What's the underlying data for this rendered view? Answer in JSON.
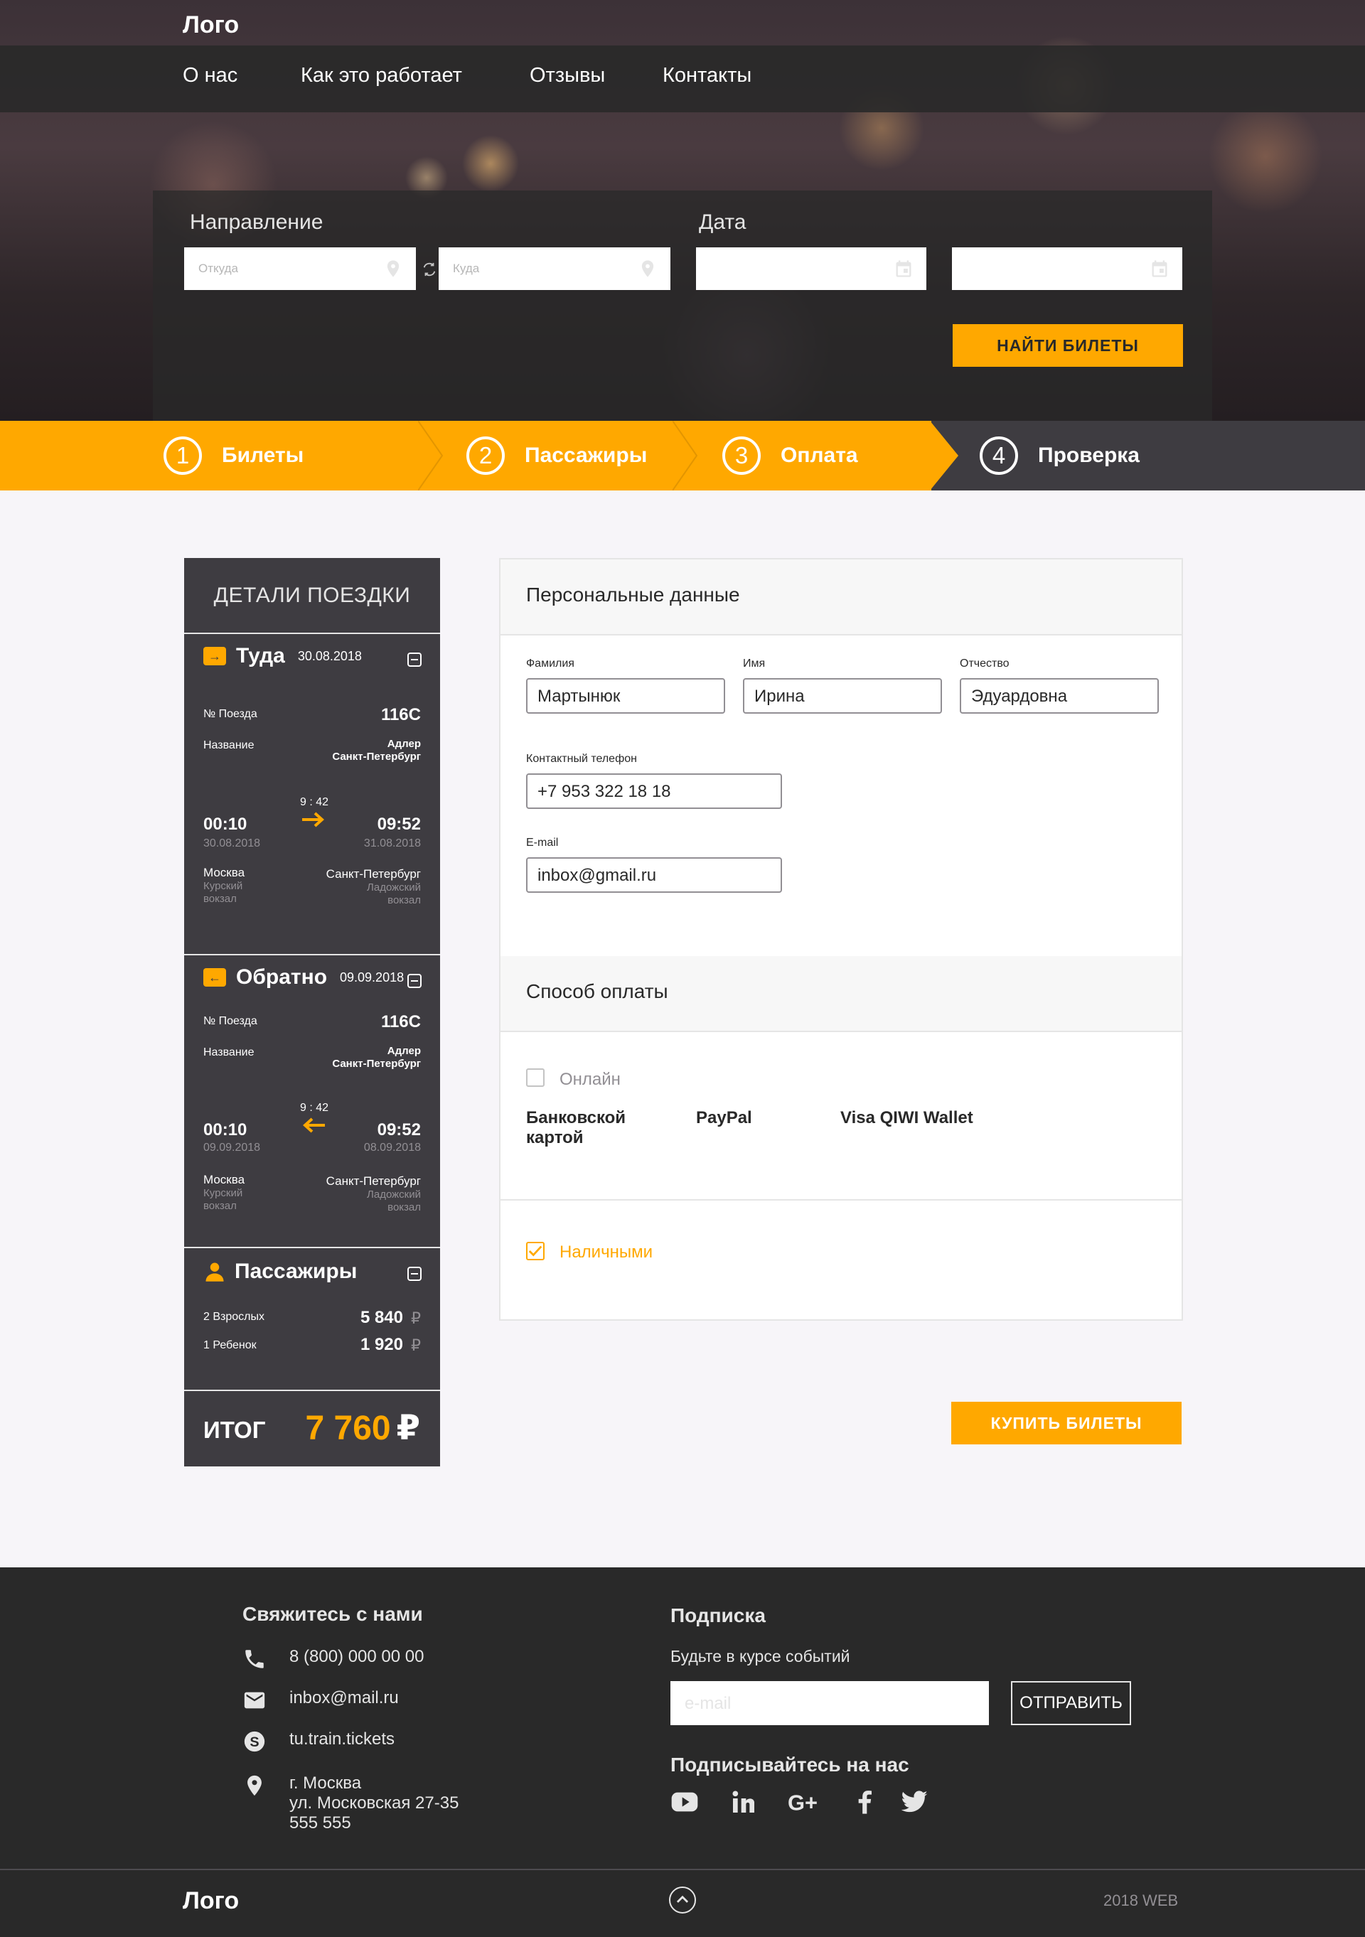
{
  "header": {
    "logo": "Лого",
    "nav": [
      "О нас",
      "Как это работает",
      "Отзывы",
      "Контакты"
    ]
  },
  "search": {
    "direction_label": "Направление",
    "date_label": "Дата",
    "from_placeholder": "Откуда",
    "to_placeholder": "Куда",
    "find_button": "НАЙТИ БИЛЕТЫ"
  },
  "steps": [
    {
      "num": "1",
      "label": "Билеты"
    },
    {
      "num": "2",
      "label": "Пассажиры"
    },
    {
      "num": "3",
      "label": "Оплата"
    },
    {
      "num": "4",
      "label": "Проверка"
    }
  ],
  "trip": {
    "title": "ДЕТАЛИ ПОЕЗДКИ",
    "there": {
      "title": "Туда",
      "date": "30.08.2018",
      "train_label": "№ Поезда",
      "train_no": "116С",
      "name_label": "Название",
      "name_line1": "Адлер",
      "name_line2": "Санкт-Петербург",
      "duration": "9 : 42",
      "dep_time": "00:10",
      "dep_date": "30.08.2018",
      "arr_time": "09:52",
      "arr_date": "31.08.2018",
      "dep_city": "Москва",
      "dep_station1": "Курский",
      "dep_station2": "вокзал",
      "arr_city": "Санкт-Петербург",
      "arr_station1": "Ладожский",
      "arr_station2": "вокзал"
    },
    "back": {
      "title": "Обратно",
      "date": "09.09.2018",
      "train_label": "№ Поезда",
      "train_no": "116С",
      "name_label": "Название",
      "name_line1": "Адлер",
      "name_line2": "Санкт-Петербург",
      "duration": "9 : 42",
      "dep_time": "00:10",
      "dep_date": "09.09.2018",
      "arr_time": "09:52",
      "arr_date": "08.09.2018",
      "dep_city": "Москва",
      "dep_station1": "Курский",
      "dep_station2": "вокзал",
      "arr_city": "Санкт-Петербург",
      "arr_station1": "Ладожский",
      "arr_station2": "вокзал"
    },
    "passengers": {
      "title": "Пассажиры",
      "adults_label": "2 Взрослых",
      "adults_price": "5 840",
      "child_label": "1 Ребенок",
      "child_price": "1 920",
      "currency": "₽"
    },
    "total_label": "ИТОГ",
    "total_value": "7 760",
    "total_currency": "₽"
  },
  "form": {
    "personal_title": "Персональные данные",
    "surname_label": "Фамилия",
    "surname": "Мартынюк",
    "name_label": "Имя",
    "name": "Ирина",
    "patronymic_label": "Отчество",
    "patronymic": "Эдуардовна",
    "phone_label": "Контактный телефон",
    "phone": "+7 953 322 18 18",
    "email_label": "E-mail",
    "email": "inbox@gmail.ru",
    "payment_title": "Способ оплаты",
    "online_label": "Онлайн",
    "methods": [
      "Банковской картой",
      "PayPal",
      "Visa QIWI Wallet"
    ],
    "cash_label": "Наличными",
    "buy_button": "КУПИТЬ БИЛЕТЫ"
  },
  "footer": {
    "contact_title": "Свяжитесь с нами",
    "phone": "8 (800) 000 00 00",
    "email": "inbox@mail.ru",
    "skype": "tu.train.tickets",
    "address1": "г. Москва",
    "address2": "ул. Московская 27-35",
    "address3": "555 555",
    "subscribe_title": "Подписка",
    "subscribe_text": "Будьте в курсе событий",
    "email_placeholder": "e-mail",
    "send_button": "ОТПРАВИТЬ",
    "follow_title": "Подписывайтесь на нас",
    "logo": "Лого",
    "copyright": "2018 WEB"
  },
  "colors": {
    "accent": "#ffa800",
    "dark": "#292929",
    "panel": "#3e3c41"
  }
}
